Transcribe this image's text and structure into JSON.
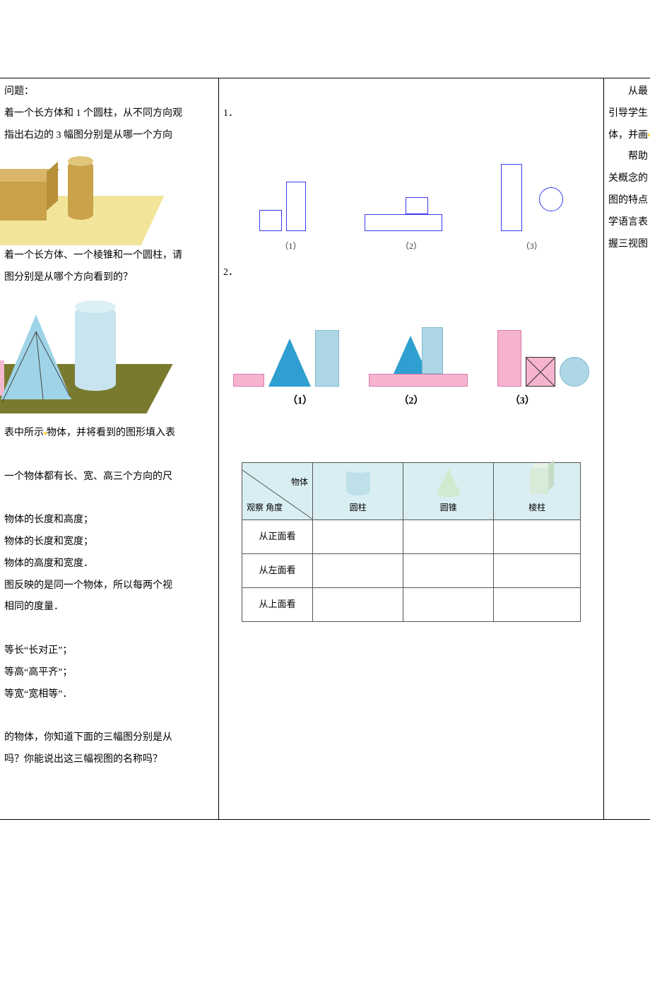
{
  "col_left": {
    "p1": "问题：",
    "p2": "着一个长方体和 1 个圆柱，从不同方向观",
    "p3": "指出右边的 3 幅图分别是从哪一个方向",
    "p4": "着一个长方体、一个棱锥和一个圆柱，请",
    "p5": "图分别是从哪个方向看到的？",
    "p6_a": "表中所示",
    "p6_b": "物体，并将看到的图形填入表",
    "p7": "一个物体都有长、宽、高三个方向的尺",
    "p8": "物体的长度和高度；",
    "p9": "物体的长度和宽度；",
    "p10": "物体的高度和宽度．",
    "p11": "图反映的是同一个物体，所以每两个视",
    "p12": "相同的度量．",
    "p13": "等长“长对正”；",
    "p14": "等高“高平齐”；",
    "p15": "等宽“宽相等”．",
    "p16": "的物体，你知道下面的三幅图分别是从",
    "p17": "吗？你能说出这三幅视图的名称吗？"
  },
  "col_mid": {
    "q1": "1．",
    "q2": "2．",
    "fig1_labels": [
      "（1）",
      "（2）",
      "（3）"
    ],
    "fig2_labels": [
      "（1）",
      "（2）",
      "（3）"
    ],
    "table": {
      "diag_top": "物体",
      "diag_bot": "观察\n角度",
      "shapes": [
        "圆柱",
        "圆锥",
        "棱柱"
      ],
      "rows": [
        "从正面看",
        "从左面看",
        "从上面看"
      ]
    }
  },
  "col_right": {
    "p1": "　　从最",
    "p2": "引导学生",
    "p3_a": "体，并画",
    "p4": "　　帮助",
    "p5": "关概念的",
    "p6": "图的特点",
    "p7": "学语言表",
    "p8": "握三视图"
  }
}
